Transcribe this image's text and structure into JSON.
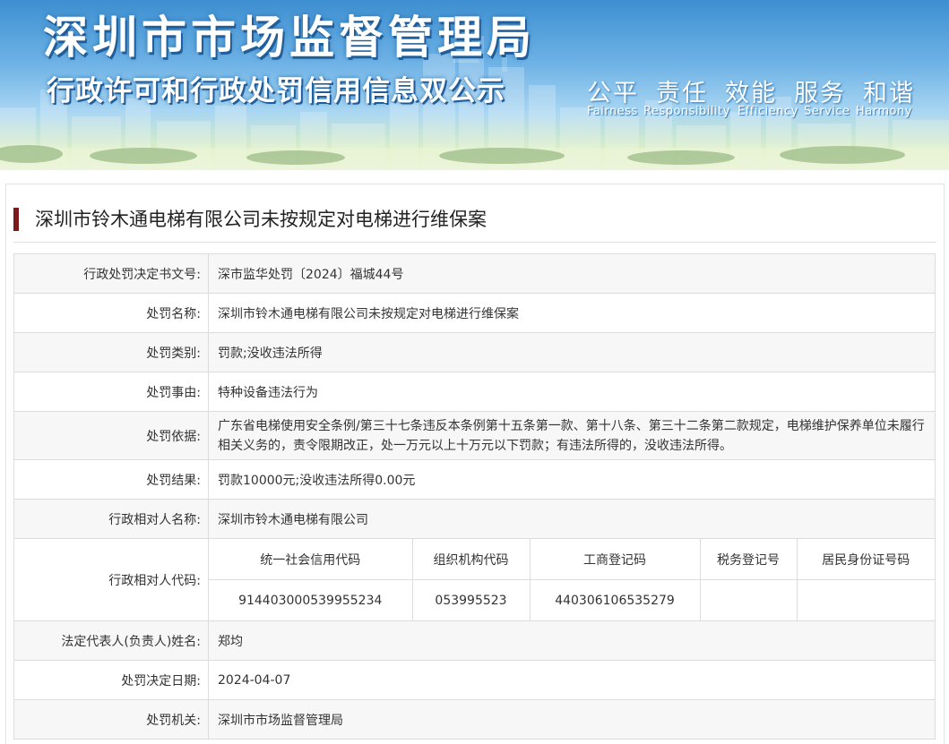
{
  "banner": {
    "title": "深圳市市场监督管理局",
    "subtitle": "行政许可和行政处罚信用信息双公示",
    "slogans": [
      {
        "cn": "公平",
        "en": "Fairness"
      },
      {
        "cn": "责任",
        "en": "Responsibility"
      },
      {
        "cn": "效能",
        "en": "Efficiency"
      },
      {
        "cn": "服务",
        "en": "Service"
      },
      {
        "cn": "和谐",
        "en": "Harmony"
      }
    ]
  },
  "page": {
    "title": "深圳市铃木通电梯有限公司未按规定对电梯进行维保案"
  },
  "fields": {
    "doc_no": {
      "label": "行政处罚决定书文号:",
      "value": "深市监华处罚〔2024〕福城44号"
    },
    "name": {
      "label": "处罚名称:",
      "value": "深圳市铃木通电梯有限公司未按规定对电梯进行维保案"
    },
    "category": {
      "label": "处罚类别:",
      "value": "罚款;没收违法所得"
    },
    "reason": {
      "label": "处罚事由:",
      "value": "特种设备违法行为"
    },
    "basis": {
      "label": "处罚依据:",
      "value": "广东省电梯使用安全条例/第三十七条违反本条例第十五条第一款、第十八条、第三十二条第二款规定，电梯维护保养单位未履行相关义务的，责令限期改正，处一万元以上十万元以下罚款；有违法所得的，没收违法所得。"
    },
    "result": {
      "label": "处罚结果:",
      "value": "罚款10000元;没收违法所得0.00元"
    },
    "party": {
      "label": "行政相对人名称:",
      "value": "深圳市铃木通电梯有限公司"
    },
    "codes": {
      "label": "行政相对人代码:",
      "headers": [
        "统一社会信用代码",
        "组织机构代码",
        "工商登记码",
        "税务登记号",
        "居民身份证号码"
      ],
      "values": [
        "914403000539955234",
        "053995523",
        "440306106535279",
        "",
        ""
      ]
    },
    "legal_rep": {
      "label": "法定代表人(负责人)姓名:",
      "value": "郑均"
    },
    "date": {
      "label": "处罚决定日期:",
      "value": "2024-04-07"
    },
    "authority": {
      "label": "处罚机关:",
      "value": "深圳市市场监督管理局"
    }
  },
  "colors": {
    "accent_bar": "#7a1a1a",
    "banner_top": "#3d8fd1",
    "row_alt": "#f7f7f7",
    "border": "#dcdcdc"
  }
}
